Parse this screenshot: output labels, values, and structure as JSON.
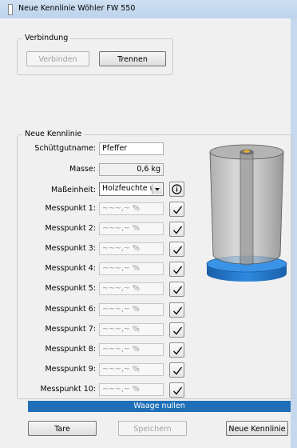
{
  "window": {
    "title": "Neue Kennlinie Wöhler FW 550"
  },
  "verbindung": {
    "legend": "Verbindung",
    "connect_label": "Verbinden",
    "disconnect_label": "Trennen"
  },
  "kennlinie": {
    "legend": "Neue Kennlinie",
    "product_label": "Schüttgutname:",
    "product_value": "Pfeffer",
    "mass_label": "Masse:",
    "mass_value": "0,6 kg",
    "unit_label": "Maßeinheit:",
    "unit_value": "Holzfeuchte u",
    "points": [
      {
        "label": "Messpunkt 1:",
        "placeholder": "~~~,~ %"
      },
      {
        "label": "Messpunkt 2:",
        "placeholder": "~~~,~ %"
      },
      {
        "label": "Messpunkt 3:",
        "placeholder": "~~~,~ %"
      },
      {
        "label": "Messpunkt 4:",
        "placeholder": "~~~,~ %"
      },
      {
        "label": "Messpunkt 5:",
        "placeholder": "~~~,~ %"
      },
      {
        "label": "Messpunkt 6:",
        "placeholder": "~~~,~ %"
      },
      {
        "label": "Messpunkt 7:",
        "placeholder": "~~~,~ %"
      },
      {
        "label": "Messpunkt 8:",
        "placeholder": "~~~,~ %"
      },
      {
        "label": "Messpunkt 9:",
        "placeholder": "~~~,~ %"
      },
      {
        "label": "Messpunkt 10:",
        "placeholder": "~~~,~ %"
      }
    ]
  },
  "status": {
    "progress_text": "Waage nullen",
    "progress": 1.0,
    "color": "#1f6fb8"
  },
  "footer": {
    "tare_label": "Tare",
    "save_label": "Speichern",
    "new_label": "Neue Kennlinie"
  },
  "icons": {
    "info": "info-icon",
    "check": "checkmark-icon",
    "device": "sample-container-illustration"
  }
}
